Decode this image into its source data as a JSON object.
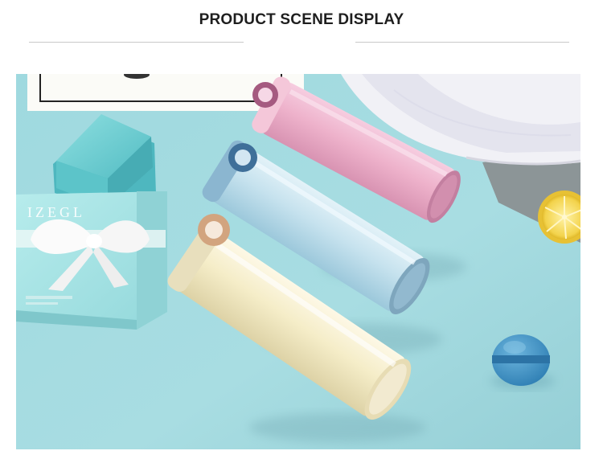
{
  "section": {
    "title": "PRODUCT SCENE DISPLAY"
  },
  "photo": {
    "box_brand_text": "IZEGL",
    "colors": {
      "backdrop": "#a9dde2",
      "pink_bottle": "#f0b5cc",
      "blue_bottle": "#c3e0ec",
      "cream_bottle": "#f6eec9",
      "gift_box": "#a7e3e4",
      "macaron": "#4b98c9",
      "lemon": "#f2d14a"
    }
  }
}
